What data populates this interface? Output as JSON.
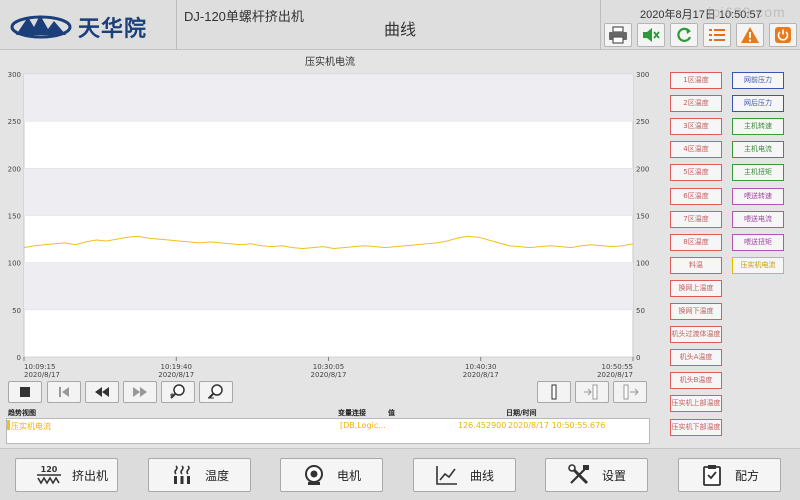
{
  "header": {
    "brand": "天华院",
    "machine_title": "DJ-120单螺杆挤出机",
    "screen_title": "曲线",
    "datetime": "2020年8月17日  10:50:57",
    "watermark": "ipi689.com",
    "icons": [
      "printer-icon",
      "mute-icon",
      "refresh-icon",
      "list-icon",
      "warning-icon",
      "power-icon"
    ]
  },
  "chart": {
    "title": "压实机电流"
  },
  "chart_data": {
    "type": "line",
    "title": "压实机电流",
    "ylim": [
      0,
      300
    ],
    "yticks": [
      0,
      50,
      100,
      150,
      200,
      250,
      300
    ],
    "x_ticks": [
      {
        "time": "10:09:15",
        "date": "2020/8/17"
      },
      {
        "time": "10:19:40",
        "date": "2020/8/17"
      },
      {
        "time": "10:30:05",
        "date": "2020/8/17"
      },
      {
        "time": "10:40:30",
        "date": "2020/8/17"
      },
      {
        "time": "10:50:55",
        "date": "2020/8/17"
      }
    ],
    "series": [
      {
        "name": "压实机电流",
        "color": "#f0c020",
        "values": [
          116,
          118,
          119,
          120,
          121,
          119,
          122,
          124,
          123,
          125,
          127,
          128,
          126,
          125,
          124,
          123,
          122,
          121,
          122,
          121,
          120,
          119,
          120,
          118,
          117,
          118,
          116,
          115,
          116,
          117,
          115,
          116,
          117,
          118,
          117,
          116,
          117,
          118,
          119,
          120,
          121,
          123,
          126,
          128,
          127,
          124,
          121,
          118,
          117,
          116,
          117,
          118,
          117,
          116,
          118,
          119,
          118,
          117,
          118,
          120
        ]
      }
    ]
  },
  "controls": {
    "left": [
      "stop-button",
      "first-button",
      "rewind-button",
      "forward-button",
      "zoom-in-button",
      "zoom-out-button"
    ],
    "right": [
      "ruler-button",
      "ruler-left-button",
      "ruler-right-button"
    ]
  },
  "table": {
    "headers": {
      "view": "趋势视图",
      "link": "变量连接",
      "value": "值",
      "datetime": "日期/时间"
    },
    "row": {
      "name": "压实机电流",
      "link": "[DB,Logic...",
      "value": "126.452900",
      "datetime": "2020/8/17 10:50:55.676"
    }
  },
  "variables": {
    "left": [
      {
        "label": "1区温度",
        "color": "red"
      },
      {
        "label": "2区温度",
        "color": "red"
      },
      {
        "label": "3区温度",
        "color": "red"
      },
      {
        "label": "4区温度",
        "color": "red"
      },
      {
        "label": "5区温度",
        "color": "red"
      },
      {
        "label": "6区温度",
        "color": "red"
      },
      {
        "label": "7区温度",
        "color": "red"
      },
      {
        "label": "8区温度",
        "color": "red"
      },
      {
        "label": "料温",
        "color": "red"
      },
      {
        "label": "换网上温度",
        "color": "red"
      },
      {
        "label": "换网下温度",
        "color": "red"
      },
      {
        "label": "机头过渡体温度",
        "color": "red"
      },
      {
        "label": "机头A温度",
        "color": "red"
      },
      {
        "label": "机头B温度",
        "color": "red"
      },
      {
        "label": "压实机上部温度",
        "color": "red"
      },
      {
        "label": "压实机下部温度",
        "color": "red"
      }
    ],
    "right": [
      {
        "label": "网前压力",
        "color": "blue"
      },
      {
        "label": "网后压力",
        "color": "blue"
      },
      {
        "label": "主机转速",
        "color": "green"
      },
      {
        "label": "主机电流",
        "color": "green"
      },
      {
        "label": "主机扭矩",
        "color": "green"
      },
      {
        "label": "喂送转速",
        "color": "purple"
      },
      {
        "label": "喂送电流",
        "color": "purple"
      },
      {
        "label": "喂送扭矩",
        "color": "purple"
      },
      {
        "label": "压实机电流",
        "color": "yellow"
      }
    ]
  },
  "nav": [
    {
      "label": "挤出机",
      "icon": "extruder-icon",
      "badge": "120"
    },
    {
      "label": "温度",
      "icon": "heater-icon"
    },
    {
      "label": "电机",
      "icon": "motor-icon"
    },
    {
      "label": "曲线",
      "icon": "curve-icon"
    },
    {
      "label": "设置",
      "icon": "tools-icon"
    },
    {
      "label": "配方",
      "icon": "recipe-icon"
    }
  ]
}
